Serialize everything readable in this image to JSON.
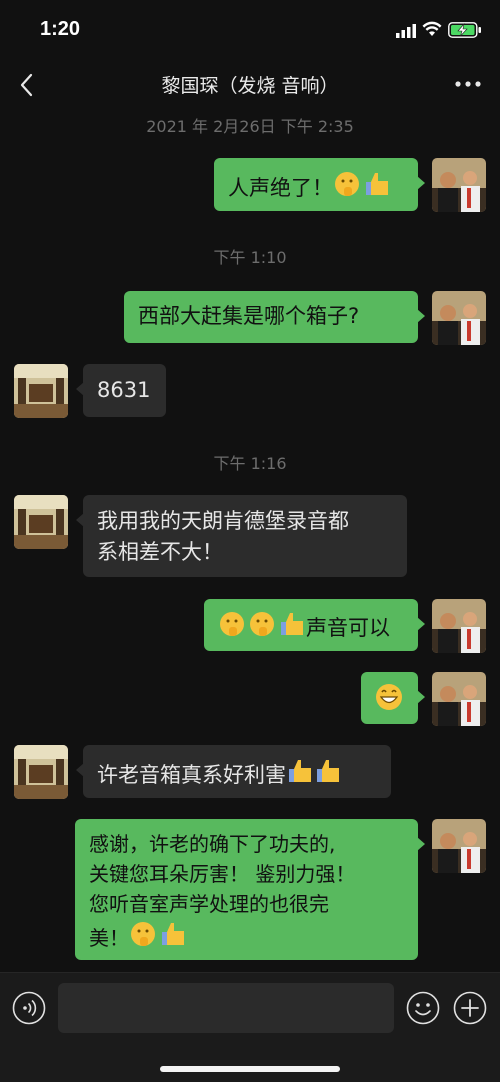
{
  "status_bar": {
    "time": "1:20"
  },
  "header": {
    "title": "黎国琛（发烧 音响）"
  },
  "timestamps": [
    "2021 年 2月26日 下午 2:35",
    "下午 1:10",
    "下午 1:16"
  ],
  "messages": [
    {
      "from": "self",
      "text": "人声绝了！",
      "emojis": [
        "shush-emoji",
        "thumbs-up-emoji"
      ]
    },
    {
      "from": "self",
      "text": "西部大赶集是哪个箱子?"
    },
    {
      "from": "other",
      "text": "8631"
    },
    {
      "from": "other",
      "lines": [
        "我用我的天朗肯德堡录音都",
        "系相差不大！"
      ]
    },
    {
      "from": "self",
      "text": "声音可以",
      "emojis": [
        "shush-emoji",
        "shush-emoji",
        "thumbs-up-emoji"
      ]
    },
    {
      "from": "self",
      "emojis": [
        "grin-emoji"
      ]
    },
    {
      "from": "other",
      "text": "许老音箱真系好利害",
      "emojis": [
        "thumbs-up-emoji",
        "thumbs-up-emoji"
      ]
    },
    {
      "from": "self",
      "lines": [
        "感谢，许老的确下了功夫的,",
        "关键您耳朵厉害！ 鉴别力强！",
        "您听音室声学处理的也很完",
        "美！"
      ],
      "emojis": [
        "shush-emoji",
        "thumbs-up-emoji"
      ]
    }
  ],
  "input": {
    "placeholder": ""
  },
  "colors": {
    "self_bubble": "#58b95e",
    "other_bubble": "#2c2c2c",
    "background": "#111111"
  }
}
